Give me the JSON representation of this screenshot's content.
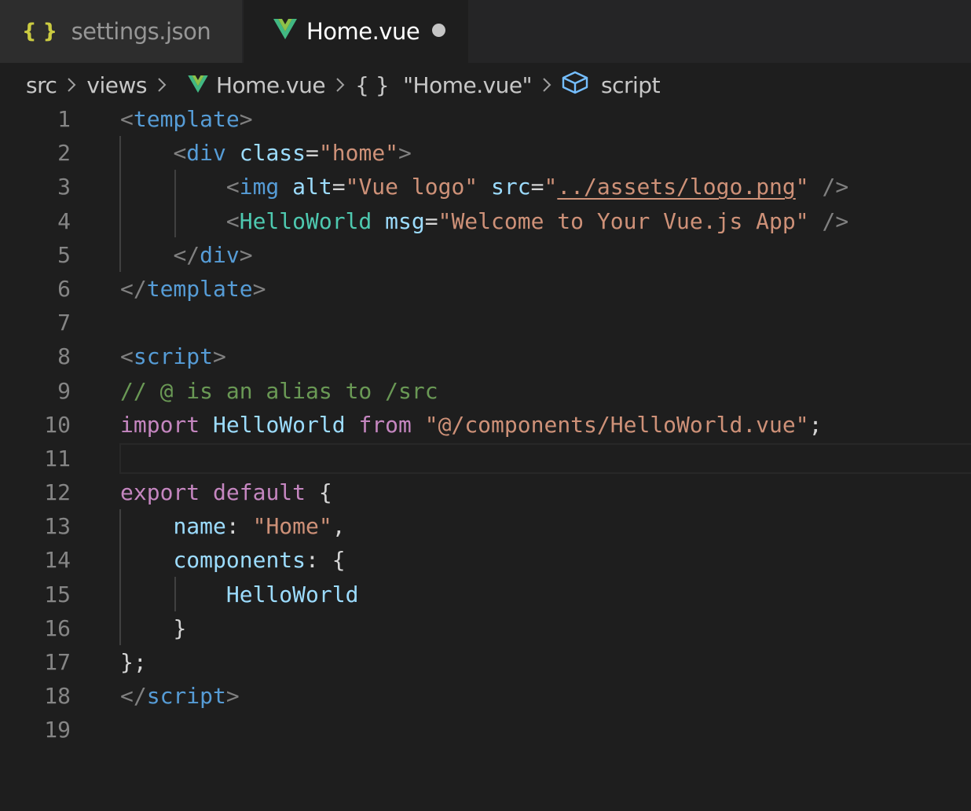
{
  "tabs": {
    "settings": {
      "label": "settings.json",
      "icon": "json-braces-icon"
    },
    "home": {
      "label": "Home.vue",
      "icon": "vue-logo-icon",
      "dirty": true
    }
  },
  "breadcrumb": {
    "src": "src",
    "views": "views",
    "file": "Home.vue",
    "braces": "{ }",
    "module": "\"Home.vue\"",
    "script": "script"
  },
  "editor": {
    "current_line": 11,
    "lines": [
      {
        "n": "1",
        "t": [
          [
            "<",
            "punct"
          ],
          [
            "template",
            "tag"
          ],
          [
            ">",
            "punct"
          ]
        ]
      },
      {
        "n": "2",
        "t": [
          [
            "    ",
            "plain"
          ],
          [
            "<",
            "punct"
          ],
          [
            "div",
            "tag"
          ],
          [
            " ",
            "plain"
          ],
          [
            "class",
            "attr"
          ],
          [
            "=",
            "plain"
          ],
          [
            "\"home\"",
            "str"
          ],
          [
            ">",
            "punct"
          ]
        ]
      },
      {
        "n": "3",
        "t": [
          [
            "        ",
            "plain"
          ],
          [
            "<",
            "punct"
          ],
          [
            "img",
            "tag"
          ],
          [
            " ",
            "plain"
          ],
          [
            "alt",
            "attr"
          ],
          [
            "=",
            "plain"
          ],
          [
            "\"Vue logo\"",
            "str"
          ],
          [
            " ",
            "plain"
          ],
          [
            "src",
            "attr"
          ],
          [
            "=",
            "plain"
          ],
          [
            "\"",
            "str"
          ],
          [
            "../assets/logo.png",
            "str-u"
          ],
          [
            "\"",
            "str"
          ],
          [
            " ",
            "plain"
          ],
          [
            "/>",
            "punct"
          ]
        ]
      },
      {
        "n": "4",
        "t": [
          [
            "        ",
            "plain"
          ],
          [
            "<",
            "punct"
          ],
          [
            "HelloWorld",
            "comp"
          ],
          [
            " ",
            "plain"
          ],
          [
            "msg",
            "attr"
          ],
          [
            "=",
            "plain"
          ],
          [
            "\"Welcome to Your Vue.js App\"",
            "str"
          ],
          [
            " ",
            "plain"
          ],
          [
            "/>",
            "punct"
          ]
        ]
      },
      {
        "n": "5",
        "t": [
          [
            "    ",
            "plain"
          ],
          [
            "</",
            "punct"
          ],
          [
            "div",
            "tag"
          ],
          [
            ">",
            "punct"
          ]
        ]
      },
      {
        "n": "6",
        "t": [
          [
            "</",
            "punct"
          ],
          [
            "template",
            "tag"
          ],
          [
            ">",
            "punct"
          ]
        ]
      },
      {
        "n": "7",
        "t": []
      },
      {
        "n": "8",
        "t": [
          [
            "<",
            "punct"
          ],
          [
            "script",
            "tag"
          ],
          [
            ">",
            "punct"
          ]
        ]
      },
      {
        "n": "9",
        "t": [
          [
            "// @ is an alias to /src",
            "com"
          ]
        ]
      },
      {
        "n": "10",
        "t": [
          [
            "import",
            "kw"
          ],
          [
            " ",
            "plain"
          ],
          [
            "HelloWorld",
            "id"
          ],
          [
            " ",
            "plain"
          ],
          [
            "from",
            "kw"
          ],
          [
            " ",
            "plain"
          ],
          [
            "\"@/components/HelloWorld.vue\"",
            "str"
          ],
          [
            ";",
            "plain"
          ]
        ]
      },
      {
        "n": "11",
        "t": []
      },
      {
        "n": "12",
        "t": [
          [
            "export",
            "kw"
          ],
          [
            " ",
            "plain"
          ],
          [
            "default",
            "kw"
          ],
          [
            " ",
            "plain"
          ],
          [
            "{",
            "plain"
          ]
        ]
      },
      {
        "n": "13",
        "t": [
          [
            "    ",
            "plain"
          ],
          [
            "name",
            "id"
          ],
          [
            ": ",
            "plain"
          ],
          [
            "\"Home\"",
            "str"
          ],
          [
            ",",
            "plain"
          ]
        ]
      },
      {
        "n": "14",
        "t": [
          [
            "    ",
            "plain"
          ],
          [
            "components",
            "id"
          ],
          [
            ": {",
            "plain"
          ]
        ]
      },
      {
        "n": "15",
        "t": [
          [
            "        ",
            "plain"
          ],
          [
            "HelloWorld",
            "id"
          ]
        ]
      },
      {
        "n": "16",
        "t": [
          [
            "    ",
            "plain"
          ],
          [
            "}",
            "plain"
          ]
        ]
      },
      {
        "n": "17",
        "t": [
          [
            "};",
            "plain"
          ]
        ]
      },
      {
        "n": "18",
        "t": [
          [
            "</",
            "punct"
          ],
          [
            "script",
            "tag"
          ],
          [
            ">",
            "punct"
          ]
        ]
      },
      {
        "n": "19",
        "t": []
      }
    ]
  }
}
